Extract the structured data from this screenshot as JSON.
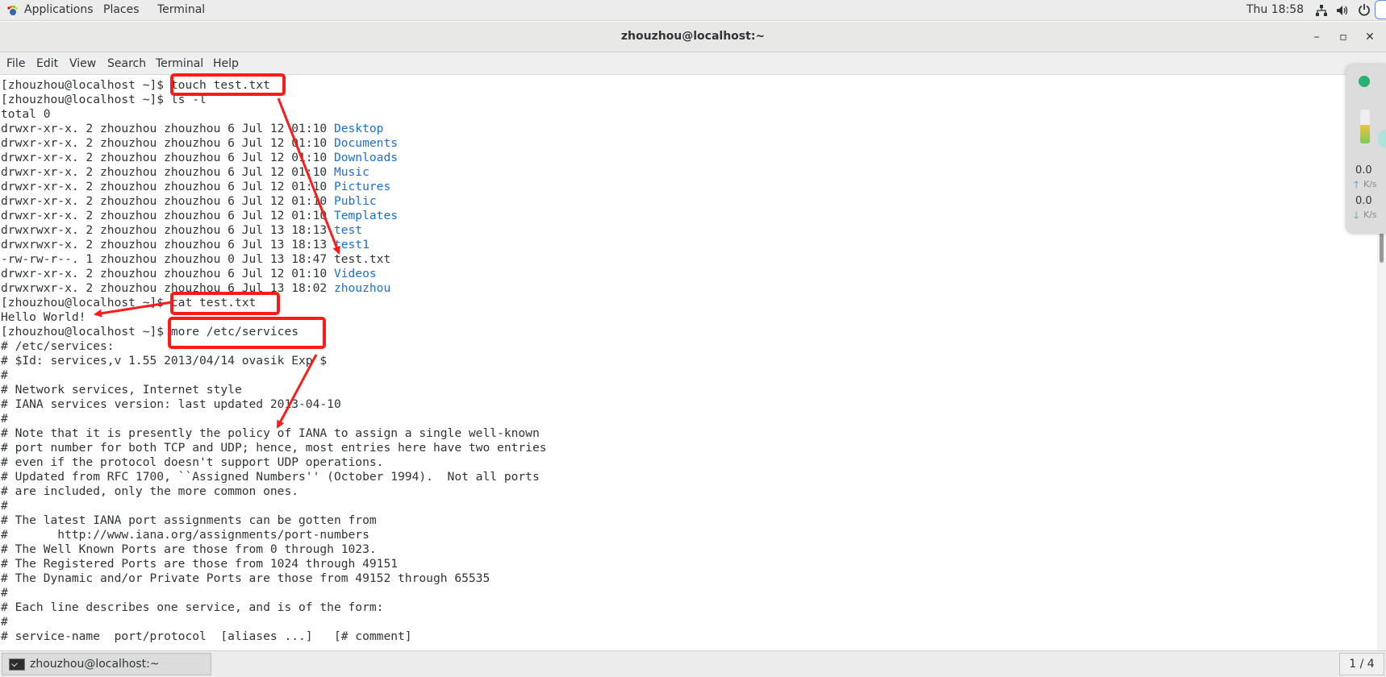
{
  "topbar": {
    "applications": "Applications",
    "places": "Places",
    "terminal": "Terminal",
    "clock": "Thu 18:58",
    "icons": [
      "apps-foot-icon",
      "network-icon",
      "volume-icon",
      "power-icon"
    ]
  },
  "window": {
    "title": "zhouzhou@localhost:~",
    "buttons": {
      "minimize": "–",
      "maximize": "▫",
      "close": "✕"
    }
  },
  "menu": [
    "File",
    "Edit",
    "View",
    "Search",
    "Terminal",
    "Help"
  ],
  "terminal": {
    "lines": [
      {
        "prompt": "[zhouzhou@localhost ~]$ ",
        "cmd": "touch test.txt"
      },
      {
        "prompt": "[zhouzhou@localhost ~]$ ",
        "cmd": "ls -l"
      },
      {
        "text": "total 0"
      },
      {
        "text": "drwxr-xr-x. 2 zhouzhou zhouzhou 6 Jul 12 01:10 ",
        "name": "Desktop",
        "color": "blue"
      },
      {
        "text": "drwxr-xr-x. 2 zhouzhou zhouzhou 6 Jul 12 01:10 ",
        "name": "Documents",
        "color": "blue"
      },
      {
        "text": "drwxr-xr-x. 2 zhouzhou zhouzhou 6 Jul 12 01:10 ",
        "name": "Downloads",
        "color": "blue"
      },
      {
        "text": "drwxr-xr-x. 2 zhouzhou zhouzhou 6 Jul 12 01:10 ",
        "name": "Music",
        "color": "blue"
      },
      {
        "text": "drwxr-xr-x. 2 zhouzhou zhouzhou 6 Jul 12 01:10 ",
        "name": "Pictures",
        "color": "blue"
      },
      {
        "text": "drwxr-xr-x. 2 zhouzhou zhouzhou 6 Jul 12 01:10 ",
        "name": "Public",
        "color": "blue"
      },
      {
        "text": "drwxr-xr-x. 2 zhouzhou zhouzhou 6 Jul 12 01:10 ",
        "name": "Templates",
        "color": "blue"
      },
      {
        "text": "drwxrwxr-x. 2 zhouzhou zhouzhou 6 Jul 13 18:13 ",
        "name": "test",
        "color": "blue"
      },
      {
        "text": "drwxrwxr-x. 2 zhouzhou zhouzhou 6 Jul 13 18:13 ",
        "name": "test1",
        "color": "blue"
      },
      {
        "text": "-rw-rw-r--. 1 zhouzhou zhouzhou 0 Jul 13 18:47 ",
        "name": "test.txt",
        "color": "plain"
      },
      {
        "text": "drwxr-xr-x. 2 zhouzhou zhouzhou 6 Jul 12 01:10 ",
        "name": "Videos",
        "color": "blue"
      },
      {
        "text": "drwxrwxr-x. 2 zhouzhou zhouzhou 6 Jul 13 18:02 ",
        "name": "zhouzhou",
        "color": "blue"
      },
      {
        "prompt": "[zhouzhou@localhost ~]$ ",
        "cmd": "cat test.txt"
      },
      {
        "text": "Hello World!"
      },
      {
        "prompt": "[zhouzhou@localhost ~]$ ",
        "cmd": "more /etc/services"
      },
      {
        "text": "# /etc/services:"
      },
      {
        "text": "# $Id: services,v 1.55 2013/04/14 ovasik Exp $"
      },
      {
        "text": "#"
      },
      {
        "text": "# Network services, Internet style"
      },
      {
        "text": "# IANA services version: last updated 2013-04-10"
      },
      {
        "text": "#"
      },
      {
        "text": "# Note that it is presently the policy of IANA to assign a single well-known"
      },
      {
        "text": "# port number for both TCP and UDP; hence, most entries here have two entries"
      },
      {
        "text": "# even if the protocol doesn't support UDP operations."
      },
      {
        "text": "# Updated from RFC 1700, ``Assigned Numbers'' (October 1994).  Not all ports"
      },
      {
        "text": "# are included, only the more common ones."
      },
      {
        "text": "#"
      },
      {
        "text": "# The latest IANA port assignments can be gotten from"
      },
      {
        "text": "#       http://www.iana.org/assignments/port-numbers"
      },
      {
        "text": "# The Well Known Ports are those from 0 through 1023."
      },
      {
        "text": "# The Registered Ports are those from 1024 through 49151"
      },
      {
        "text": "# The Dynamic and/or Private Ports are those from 49152 through 65535"
      },
      {
        "text": "#"
      },
      {
        "text": "# Each line describes one service, and is of the form:"
      },
      {
        "text": "#"
      },
      {
        "text": "# service-name  port/protocol  [aliases ...]   [# comment]"
      }
    ]
  },
  "colors": {
    "link_blue": "#1c6ed1",
    "annotation_red": "#ff1a1a",
    "text": "#2e3436"
  },
  "monitor": {
    "up_value": "0.0",
    "up_unit": "K/s",
    "down_value": "0.0",
    "down_unit": "K/s",
    "gauge_level_percent": 55
  },
  "taskbar": {
    "window_label": "zhouzhou@localhost:~",
    "page": "1 / 4"
  }
}
